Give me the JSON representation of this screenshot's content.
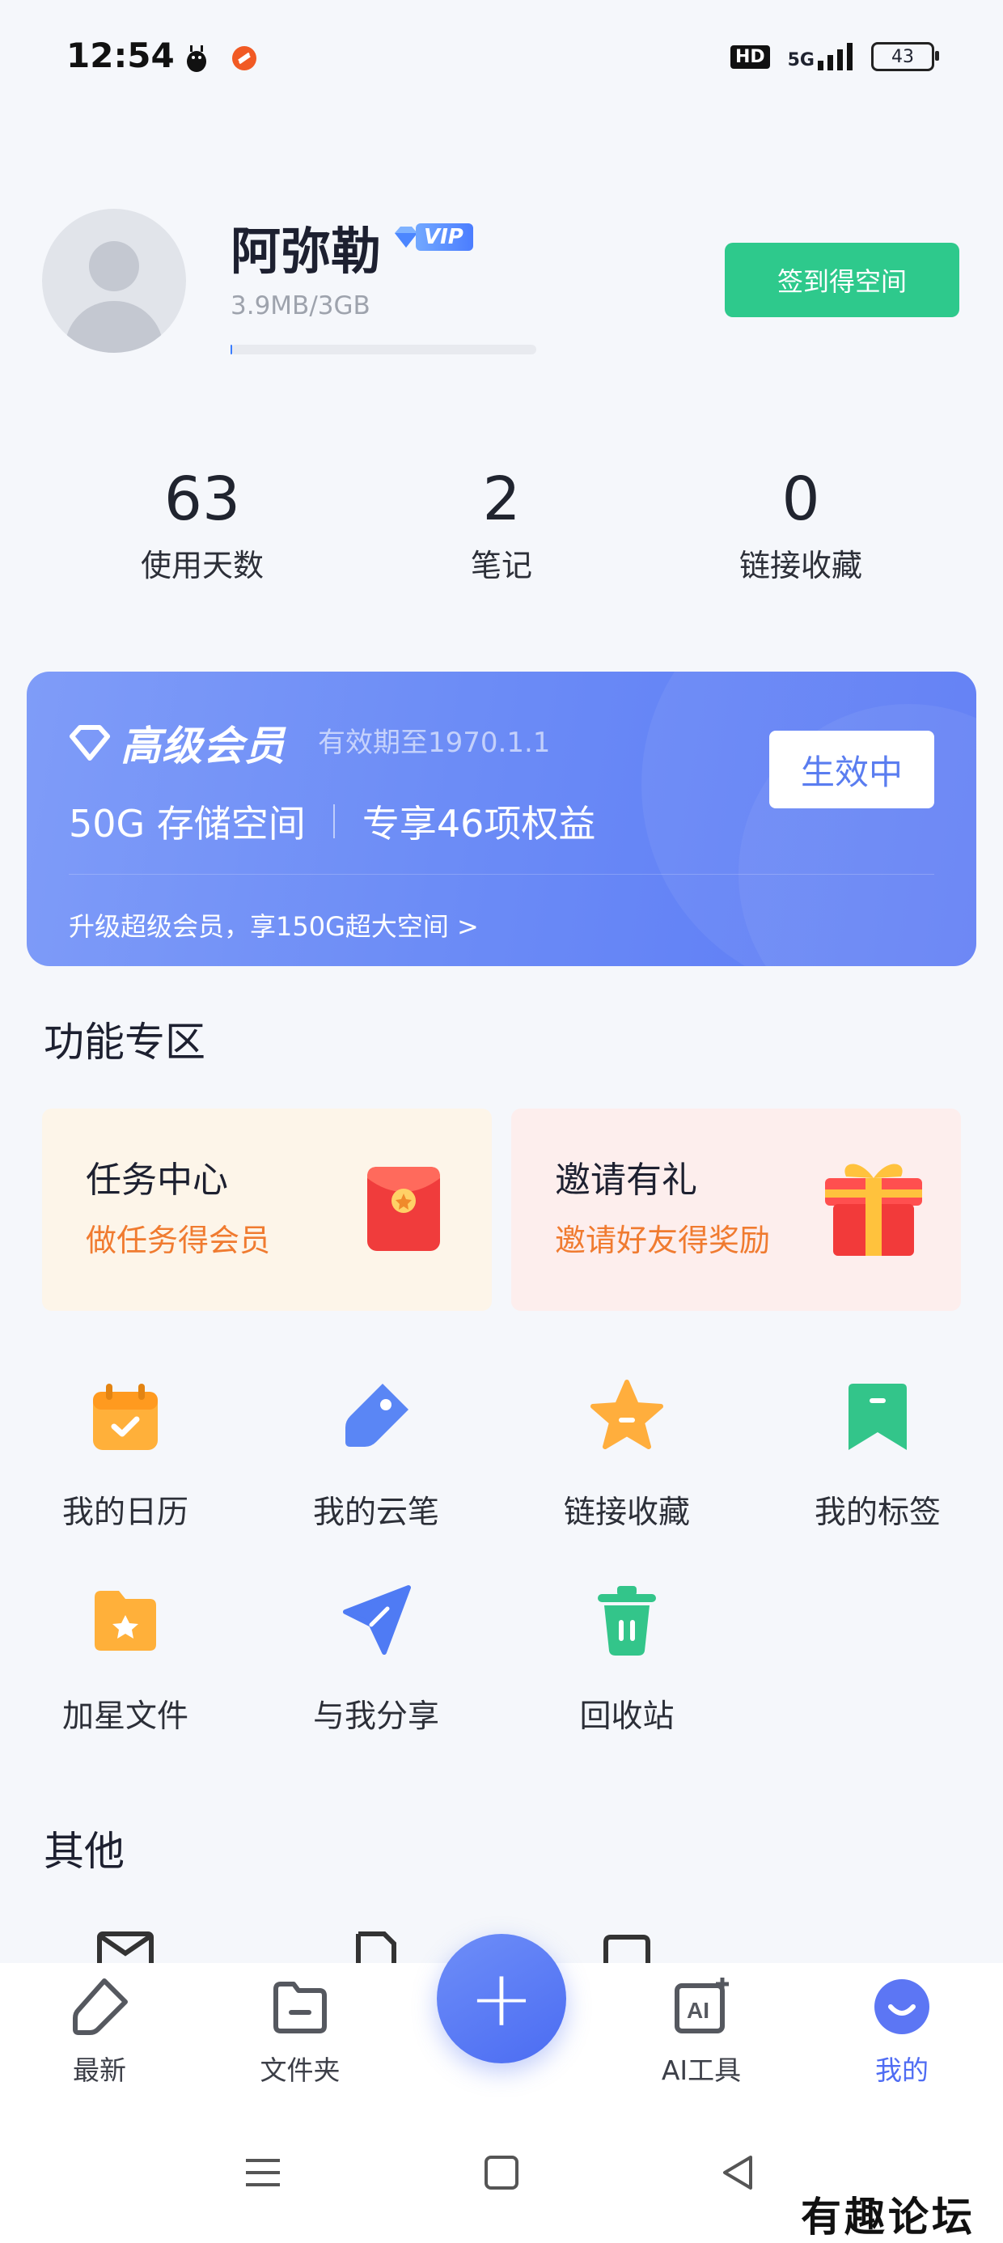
{
  "status_bar": {
    "time": "12:54",
    "hd": "HD",
    "network": "5G",
    "battery": "43"
  },
  "profile": {
    "name": "阿弥勒",
    "vip_label": "VIP",
    "storage": "3.9MB/3GB",
    "storage_used_fraction": 0.0013,
    "signin_label": "签到得空间"
  },
  "stats": [
    {
      "value": "63",
      "label": "使用天数"
    },
    {
      "value": "2",
      "label": "笔记"
    },
    {
      "value": "0",
      "label": "链接收藏"
    }
  ],
  "vip_card": {
    "title": "高级会员",
    "expire": "有效期至1970.1.1",
    "storage_benefit": "50G 存储空间",
    "rights_benefit": "专享46项权益",
    "upgrade": "升级超级会员，享150G超大空间 >",
    "status": "生效中"
  },
  "feature_section": {
    "title": "功能专区"
  },
  "promos": [
    {
      "title": "任务中心",
      "subtitle": "做任务得会员",
      "icon": "red-envelope-icon"
    },
    {
      "title": "邀请有礼",
      "subtitle": "邀请好友得奖励",
      "icon": "gift-box-icon"
    }
  ],
  "grid": [
    {
      "label": "我的日历",
      "icon": "calendar-icon"
    },
    {
      "label": "我的云笔",
      "icon": "cloud-pen-icon"
    },
    {
      "label": "链接收藏",
      "icon": "star-icon"
    },
    {
      "label": "我的标签",
      "icon": "bookmark-icon"
    },
    {
      "label": "加星文件",
      "icon": "starred-folder-icon"
    },
    {
      "label": "与我分享",
      "icon": "send-icon"
    },
    {
      "label": "回收站",
      "icon": "trash-icon"
    }
  ],
  "other_section": {
    "title": "其他"
  },
  "bottom_nav": [
    {
      "label": "最新",
      "icon": "recent-icon"
    },
    {
      "label": "文件夹",
      "icon": "folder-icon"
    },
    {
      "label": "AI工具",
      "icon": "ai-tools-icon"
    },
    {
      "label": "我的",
      "icon": "profile-icon",
      "active": true
    }
  ],
  "watermark": "有趣论坛",
  "colors": {
    "accent": "#4f6cf3",
    "green": "#2ec98c",
    "orange": "#f07b30"
  }
}
